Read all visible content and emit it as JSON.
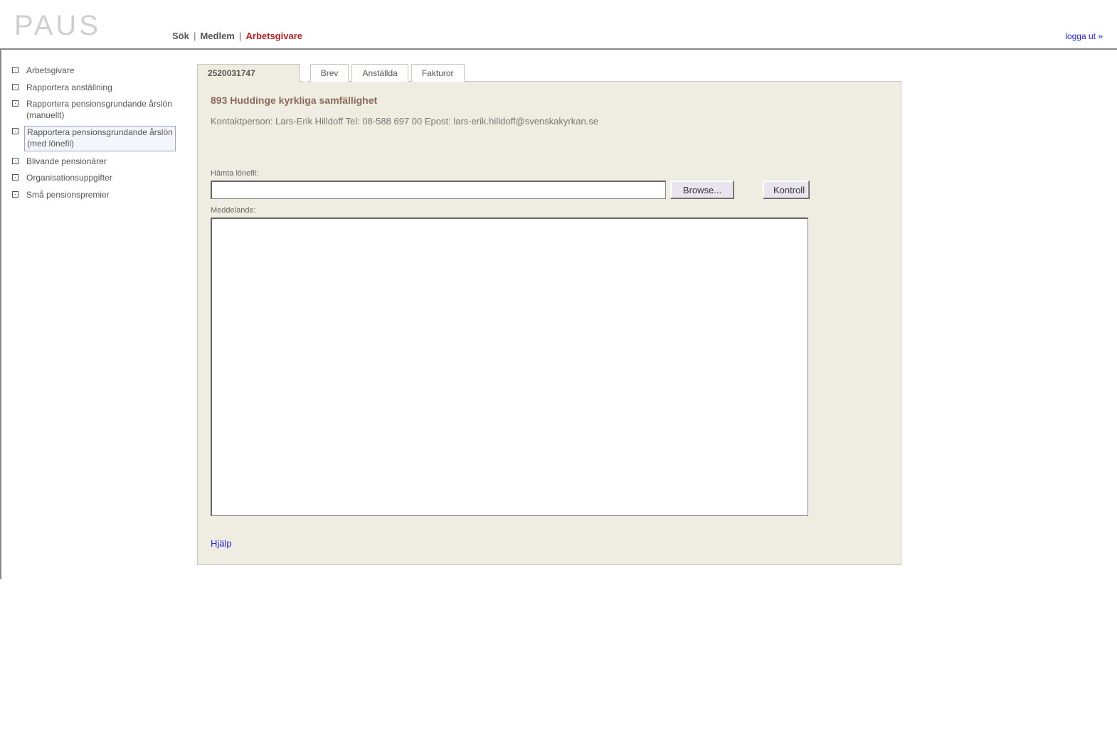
{
  "app": {
    "logo": "PAUS"
  },
  "topnav": {
    "items": [
      {
        "label": "Sök",
        "active": false
      },
      {
        "label": "Medlem",
        "active": false
      },
      {
        "label": "Arbetsgivare",
        "active": true
      }
    ],
    "logout_label": "logga ut »"
  },
  "sidebar": {
    "items": [
      {
        "label": "Arbetsgivare",
        "selected": false
      },
      {
        "label": "Rapportera anställning",
        "selected": false
      },
      {
        "label": "Rapportera pensionsgrundande årslön (manuellt)",
        "selected": false
      },
      {
        "label": "Rapportera pensionsgrundande årslön (med lönefil)",
        "selected": true
      },
      {
        "label": "Blivande pensionärer",
        "selected": false
      },
      {
        "label": "Organisationsuppgifter",
        "selected": false
      },
      {
        "label": "Små pensionspremier",
        "selected": false
      }
    ]
  },
  "tabs": [
    {
      "label": "2520031747",
      "active": true
    },
    {
      "label": "Brev",
      "active": false
    },
    {
      "label": "Anställda",
      "active": false
    },
    {
      "label": "Fakturor",
      "active": false
    }
  ],
  "main": {
    "org_heading": "893 Huddinge kyrkliga samfällighet",
    "contact_line": "Kontaktperson: Lars-Erik Hilldoff Tel: 08-588 697 00 Epost: lars-erik.hilldoff@svenskakyrkan.se",
    "fetch_file_label": "Hämta lönefil:",
    "file_value": "",
    "browse_label": "Browse...",
    "kontroll_label": "Kontroll",
    "message_label": "Meddelande:",
    "message_value": "",
    "help_label": "Hjälp"
  }
}
